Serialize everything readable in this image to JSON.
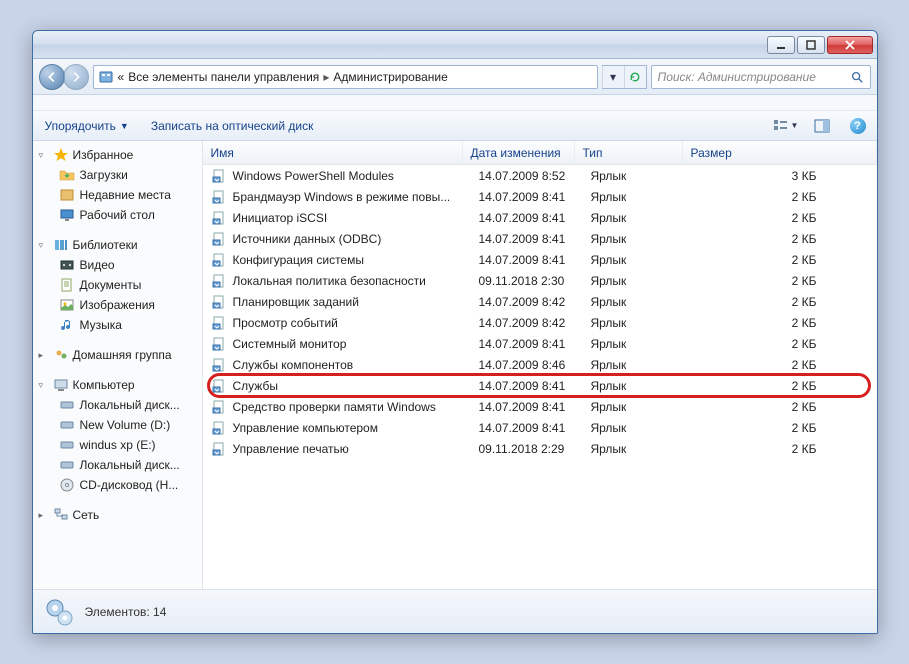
{
  "window": {
    "breadcrumb_prefix": "«",
    "breadcrumb_1": "Все элементы панели управления",
    "breadcrumb_2": "Администрирование",
    "search_placeholder": "Поиск: Администрирование"
  },
  "toolbar": {
    "organize": "Упорядочить",
    "burn": "Записать на оптический диск"
  },
  "columns": {
    "name": "Имя",
    "date": "Дата изменения",
    "type": "Тип",
    "size": "Размер"
  },
  "nav": {
    "favorites": "Избранное",
    "fav_items": {
      "downloads": "Загрузки",
      "recent": "Недавние места",
      "desktop": "Рабочий стол"
    },
    "libraries": "Библиотеки",
    "lib_items": {
      "videos": "Видео",
      "documents": "Документы",
      "pictures": "Изображения",
      "music": "Музыка"
    },
    "homegroup": "Домашняя группа",
    "computer": "Компьютер",
    "comp_items": {
      "local1": "Локальный диск...",
      "newvol": "New Volume (D:)",
      "winxp": "windus xp (E:)",
      "local2": "Локальный диск...",
      "cd": "CD-дисковод (H..."
    },
    "network": "Сеть"
  },
  "files": [
    {
      "name": "Windows PowerShell Modules",
      "date": "14.07.2009 8:52",
      "type": "Ярлык",
      "size": "3 КБ"
    },
    {
      "name": "Брандмауэр Windows в режиме повы...",
      "date": "14.07.2009 8:41",
      "type": "Ярлык",
      "size": "2 КБ"
    },
    {
      "name": "Инициатор iSCSI",
      "date": "14.07.2009 8:41",
      "type": "Ярлык",
      "size": "2 КБ"
    },
    {
      "name": "Источники данных (ODBC)",
      "date": "14.07.2009 8:41",
      "type": "Ярлык",
      "size": "2 КБ"
    },
    {
      "name": "Конфигурация системы",
      "date": "14.07.2009 8:41",
      "type": "Ярлык",
      "size": "2 КБ"
    },
    {
      "name": "Локальная политика безопасности",
      "date": "09.11.2018 2:30",
      "type": "Ярлык",
      "size": "2 КБ"
    },
    {
      "name": "Планировщик заданий",
      "date": "14.07.2009 8:42",
      "type": "Ярлык",
      "size": "2 КБ"
    },
    {
      "name": "Просмотр событий",
      "date": "14.07.2009 8:42",
      "type": "Ярлык",
      "size": "2 КБ"
    },
    {
      "name": "Системный монитор",
      "date": "14.07.2009 8:41",
      "type": "Ярлык",
      "size": "2 КБ"
    },
    {
      "name": "Службы компонентов",
      "date": "14.07.2009 8:46",
      "type": "Ярлык",
      "size": "2 КБ"
    },
    {
      "name": "Службы",
      "date": "14.07.2009 8:41",
      "type": "Ярлык",
      "size": "2 КБ",
      "highlight": true
    },
    {
      "name": "Средство проверки памяти Windows",
      "date": "14.07.2009 8:41",
      "type": "Ярлык",
      "size": "2 КБ"
    },
    {
      "name": "Управление компьютером",
      "date": "14.07.2009 8:41",
      "type": "Ярлык",
      "size": "2 КБ"
    },
    {
      "name": "Управление печатью",
      "date": "09.11.2018 2:29",
      "type": "Ярлык",
      "size": "2 КБ"
    }
  ],
  "status": {
    "text": "Элементов: 14"
  }
}
